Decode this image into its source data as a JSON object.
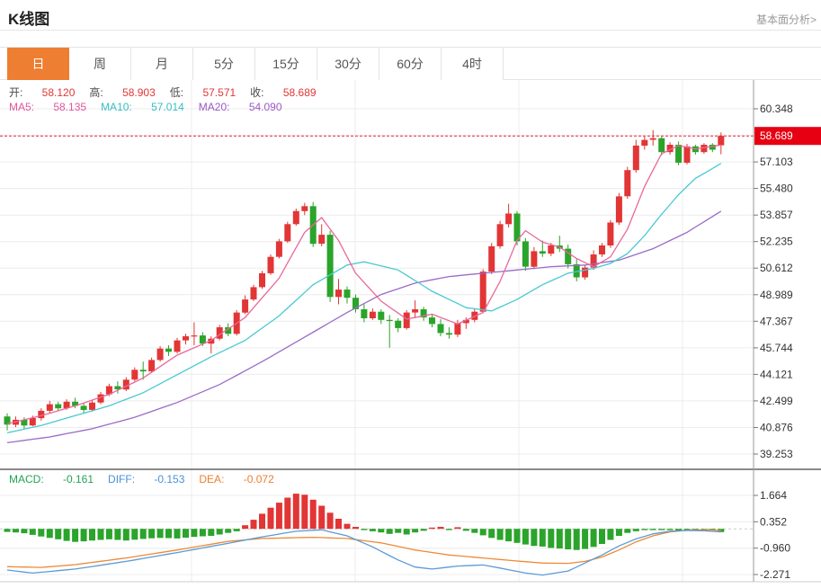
{
  "header": {
    "title": "K线图",
    "link": "基本面分析>"
  },
  "tabs": [
    {
      "label": "日",
      "active": true
    },
    {
      "label": "周",
      "active": false
    },
    {
      "label": "月",
      "active": false
    },
    {
      "label": "5分",
      "active": false
    },
    {
      "label": "15分",
      "active": false
    },
    {
      "label": "30分",
      "active": false
    },
    {
      "label": "60分",
      "active": false
    },
    {
      "label": "4时",
      "active": false
    }
  ],
  "ohlc_legend": [
    {
      "label": "开:",
      "value": "58.120"
    },
    {
      "label": "高:",
      "value": "58.903"
    },
    {
      "label": "低:",
      "value": "57.571"
    },
    {
      "label": "收:",
      "value": "58.689"
    }
  ],
  "ma_legend": [
    {
      "label": "MA5:",
      "value": "58.135",
      "color": "#e1559d"
    },
    {
      "label": "MA10:",
      "value": "57.014",
      "color": "#36bfc5"
    },
    {
      "label": "MA20:",
      "value": "54.090",
      "color": "#9b59c8"
    }
  ],
  "macd_legend": [
    {
      "label": "MACD:",
      "value": "-0.161",
      "color": "#21a355"
    },
    {
      "label": "DIFF:",
      "value": "-0.153",
      "color": "#4a90d9"
    },
    {
      "label": "DEA:",
      "value": "-0.072",
      "color": "#ed7d31"
    }
  ],
  "colors": {
    "up": "#e23535",
    "down": "#2aa42a",
    "ma5": "#e8689a",
    "ma10": "#49c8d2",
    "ma20": "#9a6bc8",
    "diff": "#5b9bd5",
    "dea": "#ed8936",
    "price_line": "#f2243c",
    "tag_bg": "#e60012",
    "tag_text": "#ffffff",
    "grid": "#ececec",
    "axis": "#999999",
    "axis_text": "#333333",
    "separator": "#444444",
    "macd_zero": "#cccccc"
  },
  "chart_data": {
    "type": "candlestick+macd",
    "price_axis_labels": [
      60.348,
      57.103,
      55.48,
      53.857,
      52.235,
      50.612,
      48.989,
      47.367,
      45.744,
      44.121,
      42.499,
      40.876,
      39.253
    ],
    "price_axis_top": 60.348,
    "price_axis_step": 1.6226,
    "last_price": 58.689,
    "macd_axis_labels": [
      1.664,
      0.352,
      -0.96,
      -2.271
    ],
    "macd_axis_top": 1.664,
    "macd_axis_step": 1.312,
    "candles": [
      [
        41.55,
        41.75,
        40.7,
        41.05
      ],
      [
        41.05,
        41.55,
        40.9,
        41.35
      ],
      [
        41.35,
        41.5,
        40.8,
        41.0
      ],
      [
        41.0,
        41.6,
        40.95,
        41.45
      ],
      [
        41.45,
        42.05,
        41.3,
        41.9
      ],
      [
        41.9,
        42.5,
        41.75,
        42.3
      ],
      [
        42.3,
        42.45,
        41.9,
        42.05
      ],
      [
        42.05,
        42.6,
        41.95,
        42.45
      ],
      [
        42.45,
        42.7,
        42.05,
        42.2
      ],
      [
        42.2,
        42.35,
        41.75,
        41.95
      ],
      [
        41.95,
        42.55,
        41.85,
        42.4
      ],
      [
        42.4,
        43.05,
        42.3,
        42.9
      ],
      [
        42.9,
        43.55,
        42.8,
        43.4
      ],
      [
        43.4,
        43.7,
        42.95,
        43.2
      ],
      [
        43.2,
        43.95,
        43.1,
        43.8
      ],
      [
        43.8,
        44.55,
        43.7,
        44.4
      ],
      [
        44.4,
        44.9,
        43.8,
        44.3
      ],
      [
        44.3,
        45.15,
        44.2,
        45.0
      ],
      [
        45.0,
        45.85,
        44.9,
        45.7
      ],
      [
        45.7,
        45.9,
        45.25,
        45.5
      ],
      [
        45.5,
        46.35,
        45.4,
        46.2
      ],
      [
        46.2,
        46.6,
        45.95,
        46.45
      ],
      [
        46.45,
        47.3,
        45.9,
        46.5
      ],
      [
        46.5,
        46.7,
        45.85,
        46.0
      ],
      [
        46.0,
        46.45,
        45.4,
        46.3
      ],
      [
        46.3,
        47.15,
        46.2,
        47.0
      ],
      [
        47.0,
        47.25,
        46.45,
        46.6
      ],
      [
        46.6,
        48.05,
        46.5,
        47.9
      ],
      [
        47.9,
        48.95,
        47.8,
        48.7
      ],
      [
        48.7,
        49.6,
        48.6,
        49.45
      ],
      [
        49.45,
        50.45,
        49.35,
        50.3
      ],
      [
        50.3,
        51.45,
        50.2,
        51.3
      ],
      [
        51.3,
        52.4,
        51.2,
        52.25
      ],
      [
        52.25,
        53.45,
        52.15,
        53.3
      ],
      [
        53.3,
        54.25,
        53.2,
        54.1
      ],
      [
        54.1,
        54.6,
        53.85,
        54.4
      ],
      [
        54.4,
        54.65,
        51.9,
        52.1
      ],
      [
        52.1,
        53.3,
        51.95,
        52.65
      ],
      [
        52.65,
        52.9,
        48.55,
        48.85
      ],
      [
        48.85,
        49.95,
        48.4,
        49.3
      ],
      [
        49.3,
        49.5,
        48.45,
        48.8
      ],
      [
        48.8,
        49.0,
        47.9,
        48.1
      ],
      [
        48.1,
        48.4,
        47.3,
        47.55
      ],
      [
        47.55,
        48.15,
        47.45,
        47.95
      ],
      [
        47.95,
        48.1,
        47.2,
        47.45
      ],
      [
        47.45,
        47.75,
        45.75,
        47.4
      ],
      [
        47.4,
        47.55,
        46.7,
        46.95
      ],
      [
        46.95,
        48.05,
        46.85,
        47.9
      ],
      [
        47.9,
        48.65,
        47.55,
        48.1
      ],
      [
        48.1,
        48.25,
        47.4,
        47.6
      ],
      [
        47.6,
        47.8,
        47.0,
        47.2
      ],
      [
        47.2,
        47.5,
        46.45,
        46.65
      ],
      [
        46.65,
        47.0,
        46.3,
        46.55
      ],
      [
        46.55,
        47.45,
        46.4,
        47.25
      ],
      [
        47.25,
        47.6,
        46.9,
        47.45
      ],
      [
        47.45,
        48.1,
        47.3,
        47.95
      ],
      [
        47.95,
        50.55,
        47.85,
        50.4
      ],
      [
        50.4,
        52.15,
        50.25,
        51.95
      ],
      [
        51.95,
        53.5,
        51.8,
        53.3
      ],
      [
        53.3,
        54.55,
        53.1,
        53.95
      ],
      [
        53.95,
        54.1,
        52.0,
        52.25
      ],
      [
        52.25,
        52.45,
        50.45,
        50.7
      ],
      [
        50.7,
        51.9,
        50.55,
        51.65
      ],
      [
        51.65,
        52.3,
        51.3,
        51.5
      ],
      [
        51.5,
        52.15,
        51.35,
        52.0
      ],
      [
        52.0,
        52.6,
        51.6,
        51.8
      ],
      [
        51.8,
        52.05,
        50.6,
        50.85
      ],
      [
        50.85,
        51.15,
        49.8,
        50.05
      ],
      [
        50.05,
        50.8,
        49.9,
        50.65
      ],
      [
        50.65,
        51.7,
        50.5,
        51.45
      ],
      [
        51.45,
        52.15,
        51.3,
        52.0
      ],
      [
        52.0,
        53.55,
        51.85,
        53.4
      ],
      [
        53.4,
        55.2,
        53.25,
        55.0
      ],
      [
        55.0,
        56.8,
        54.85,
        56.6
      ],
      [
        56.6,
        58.45,
        56.45,
        58.1
      ],
      [
        58.1,
        58.65,
        57.85,
        58.45
      ],
      [
        58.45,
        59.05,
        58.1,
        58.55
      ],
      [
        58.55,
        58.65,
        57.5,
        57.7
      ],
      [
        57.7,
        58.3,
        57.55,
        58.15
      ],
      [
        58.15,
        58.35,
        56.9,
        57.05
      ],
      [
        57.05,
        58.2,
        56.95,
        58.05
      ],
      [
        58.05,
        58.15,
        57.55,
        57.7
      ],
      [
        57.7,
        58.25,
        57.6,
        58.15
      ],
      [
        58.15,
        58.25,
        57.7,
        57.85
      ],
      [
        58.12,
        58.903,
        57.571,
        58.689
      ]
    ],
    "ma5_keypoints": [
      [
        0,
        41.1
      ],
      [
        4,
        41.6
      ],
      [
        8,
        42.2
      ],
      [
        12,
        42.9
      ],
      [
        16,
        43.9
      ],
      [
        20,
        45.3
      ],
      [
        24,
        46.2
      ],
      [
        28,
        47.6
      ],
      [
        32,
        50.0
      ],
      [
        35,
        52.8
      ],
      [
        37,
        53.7
      ],
      [
        39,
        52.3
      ],
      [
        41,
        50.3
      ],
      [
        44,
        48.6
      ],
      [
        47,
        47.5
      ],
      [
        50,
        47.8
      ],
      [
        53,
        47.2
      ],
      [
        56,
        47.9
      ],
      [
        58,
        49.8
      ],
      [
        60,
        52.3
      ],
      [
        61,
        52.9
      ],
      [
        63,
        52.2
      ],
      [
        65,
        51.9
      ],
      [
        67,
        51.2
      ],
      [
        69,
        50.7
      ],
      [
        71,
        51.3
      ],
      [
        73,
        53.0
      ],
      [
        75,
        55.6
      ],
      [
        77,
        57.6
      ],
      [
        79,
        58.1
      ],
      [
        81,
        57.9
      ],
      [
        84,
        58.135
      ]
    ],
    "ma10_keypoints": [
      [
        0,
        40.55
      ],
      [
        4,
        41.0
      ],
      [
        8,
        41.6
      ],
      [
        12,
        42.2
      ],
      [
        16,
        43.0
      ],
      [
        20,
        44.1
      ],
      [
        24,
        45.2
      ],
      [
        28,
        46.2
      ],
      [
        32,
        47.7
      ],
      [
        36,
        49.6
      ],
      [
        40,
        50.8
      ],
      [
        42,
        51.0
      ],
      [
        46,
        50.5
      ],
      [
        50,
        49.2
      ],
      [
        54,
        48.2
      ],
      [
        57,
        48.0
      ],
      [
        60,
        48.7
      ],
      [
        63,
        49.6
      ],
      [
        66,
        50.3
      ],
      [
        69,
        50.6
      ],
      [
        71,
        50.9
      ],
      [
        73,
        51.5
      ],
      [
        75,
        52.6
      ],
      [
        77,
        53.9
      ],
      [
        79,
        55.1
      ],
      [
        81,
        56.1
      ],
      [
        83,
        56.7
      ],
      [
        84,
        57.014
      ]
    ],
    "ma20_keypoints": [
      [
        0,
        39.95
      ],
      [
        5,
        40.3
      ],
      [
        10,
        40.8
      ],
      [
        15,
        41.5
      ],
      [
        20,
        42.4
      ],
      [
        25,
        43.5
      ],
      [
        30,
        44.9
      ],
      [
        35,
        46.4
      ],
      [
        40,
        47.9
      ],
      [
        44,
        49.0
      ],
      [
        48,
        49.7
      ],
      [
        52,
        50.1
      ],
      [
        56,
        50.3
      ],
      [
        60,
        50.5
      ],
      [
        64,
        50.7
      ],
      [
        68,
        50.8
      ],
      [
        72,
        51.1
      ],
      [
        76,
        51.8
      ],
      [
        80,
        52.8
      ],
      [
        84,
        54.09
      ]
    ],
    "macd_hist": [
      -0.15,
      -0.18,
      -0.22,
      -0.3,
      -0.38,
      -0.45,
      -0.52,
      -0.6,
      -0.65,
      -0.62,
      -0.58,
      -0.55,
      -0.52,
      -0.55,
      -0.58,
      -0.54,
      -0.5,
      -0.47,
      -0.45,
      -0.46,
      -0.48,
      -0.44,
      -0.4,
      -0.37,
      -0.35,
      -0.28,
      -0.2,
      -0.12,
      0.18,
      0.45,
      0.75,
      1.05,
      1.3,
      1.55,
      1.75,
      1.7,
      1.45,
      1.15,
      0.8,
      0.5,
      0.25,
      0.1,
      -0.05,
      -0.12,
      -0.18,
      -0.25,
      -0.2,
      -0.28,
      -0.18,
      -0.1,
      0.06,
      0.1,
      -0.06,
      0.08,
      -0.1,
      -0.2,
      -0.32,
      -0.45,
      -0.55,
      -0.62,
      -0.7,
      -0.78,
      -0.85,
      -0.88,
      -0.95,
      -0.98,
      -1.02,
      -1.05,
      -1.0,
      -0.9,
      -0.75,
      -0.55,
      -0.35,
      -0.2,
      -0.12,
      -0.06,
      -0.03,
      -0.02,
      -0.06,
      -0.1,
      -0.05,
      -0.02,
      -0.02,
      -0.03,
      -0.161
    ],
    "diff_keypoints": [
      [
        0,
        -2.05
      ],
      [
        3,
        -2.2
      ],
      [
        8,
        -2.0
      ],
      [
        14,
        -1.62
      ],
      [
        20,
        -1.18
      ],
      [
        26,
        -0.72
      ],
      [
        30,
        -0.4
      ],
      [
        34,
        -0.12
      ],
      [
        37,
        -0.05
      ],
      [
        40,
        -0.35
      ],
      [
        43,
        -0.9
      ],
      [
        46,
        -1.55
      ],
      [
        48,
        -1.9
      ],
      [
        50,
        -2.0
      ],
      [
        53,
        -1.85
      ],
      [
        56,
        -1.8
      ],
      [
        58,
        -1.95
      ],
      [
        61,
        -2.2
      ],
      [
        63,
        -2.3
      ],
      [
        66,
        -2.1
      ],
      [
        68,
        -1.7
      ],
      [
        70,
        -1.3
      ],
      [
        72,
        -0.85
      ],
      [
        74,
        -0.5
      ],
      [
        76,
        -0.25
      ],
      [
        78,
        -0.12
      ],
      [
        80,
        -0.08
      ],
      [
        82,
        -0.1
      ],
      [
        84,
        -0.153
      ]
    ],
    "dea_keypoints": [
      [
        0,
        -1.88
      ],
      [
        4,
        -1.92
      ],
      [
        8,
        -1.78
      ],
      [
        14,
        -1.45
      ],
      [
        20,
        -1.05
      ],
      [
        26,
        -0.62
      ],
      [
        30,
        -0.48
      ],
      [
        33,
        -0.45
      ],
      [
        36,
        -0.42
      ],
      [
        40,
        -0.48
      ],
      [
        44,
        -0.7
      ],
      [
        48,
        -1.05
      ],
      [
        52,
        -1.3
      ],
      [
        56,
        -1.45
      ],
      [
        60,
        -1.6
      ],
      [
        63,
        -1.7
      ],
      [
        66,
        -1.72
      ],
      [
        68,
        -1.62
      ],
      [
        70,
        -1.4
      ],
      [
        72,
        -1.05
      ],
      [
        74,
        -0.65
      ],
      [
        76,
        -0.35
      ],
      [
        78,
        -0.15
      ],
      [
        80,
        -0.07
      ],
      [
        82,
        -0.05
      ],
      [
        84,
        -0.072
      ]
    ]
  }
}
